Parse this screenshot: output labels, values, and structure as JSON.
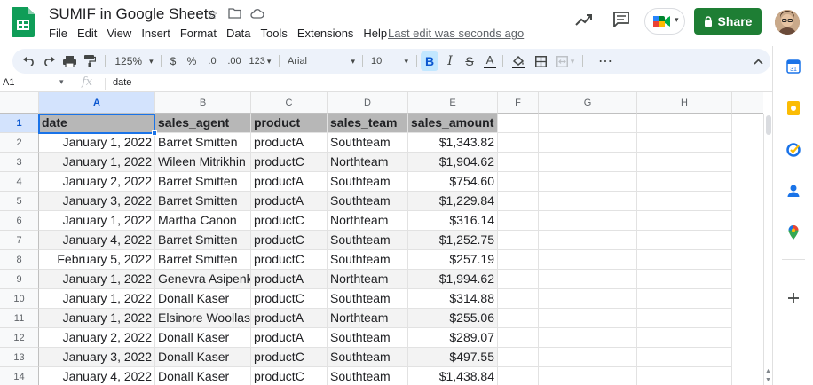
{
  "app": {
    "doc_title": "SUMIF in Google Sheets",
    "menus": [
      "File",
      "Edit",
      "View",
      "Insert",
      "Format",
      "Data",
      "Tools",
      "Extensions",
      "Help"
    ],
    "last_edit": "Last edit was seconds ago",
    "share_label": "Share",
    "brand_color": "#1e7e34"
  },
  "toolbar": {
    "zoom": "125%",
    "currency": "$",
    "percent": "%",
    "decrease_decimal": ".0",
    "increase_decimal": ".00",
    "number_format": "123",
    "font": "Arial",
    "font_size": "10",
    "bold": "B",
    "italic": "I",
    "strike": "S",
    "text_color": "A",
    "more": "⋯"
  },
  "formula_bar": {
    "cell_ref": "A1",
    "fx": "fx",
    "value": "date"
  },
  "grid": {
    "columns": [
      "A",
      "B",
      "C",
      "D",
      "E",
      "F",
      "G",
      "H"
    ],
    "row_numbers": [
      "1",
      "2",
      "3",
      "4",
      "5",
      "6",
      "7",
      "8",
      "9",
      "10",
      "11",
      "12",
      "13",
      "14"
    ],
    "header": [
      "date",
      "sales_agent",
      "product",
      "sales_team",
      "sales_amount"
    ],
    "rows": [
      [
        "January 1, 2022",
        "Barret Smitten",
        "productA",
        "Southteam",
        "$1,343.82"
      ],
      [
        "January 1, 2022",
        "Wileen Mitrikhin",
        "productC",
        "Northteam",
        "$1,904.62"
      ],
      [
        "January 2, 2022",
        "Barret Smitten",
        "productA",
        "Southteam",
        "$754.60"
      ],
      [
        "January 3, 2022",
        "Barret Smitten",
        "productA",
        "Southteam",
        "$1,229.84"
      ],
      [
        "January 1, 2022",
        "Martha Canon",
        "productC",
        "Northteam",
        "$316.14"
      ],
      [
        "January 4, 2022",
        "Barret Smitten",
        "productC",
        "Southteam",
        "$1,252.75"
      ],
      [
        "February 5, 2022",
        "Barret Smitten",
        "productC",
        "Southteam",
        "$257.19"
      ],
      [
        "January 1, 2022",
        "Genevra Asipenko",
        "productA",
        "Northteam",
        "$1,994.62"
      ],
      [
        "January 1, 2022",
        "Donall Kaser",
        "productC",
        "Southteam",
        "$314.88"
      ],
      [
        "January 1, 2022",
        "Elsinore Woollaston",
        "productA",
        "Northteam",
        "$255.06"
      ],
      [
        "January 2, 2022",
        "Donall Kaser",
        "productA",
        "Southteam",
        "$289.07"
      ],
      [
        "January 3, 2022",
        "Donall Kaser",
        "productC",
        "Southteam",
        "$497.55"
      ],
      [
        "January 4, 2022",
        "Donall Kaser",
        "productC",
        "Southteam",
        "$1,438.84"
      ]
    ]
  },
  "side_panel": {
    "icons": [
      "calendar-icon",
      "keep-icon",
      "tasks-icon",
      "contacts-icon",
      "maps-icon",
      "add-icon"
    ]
  }
}
